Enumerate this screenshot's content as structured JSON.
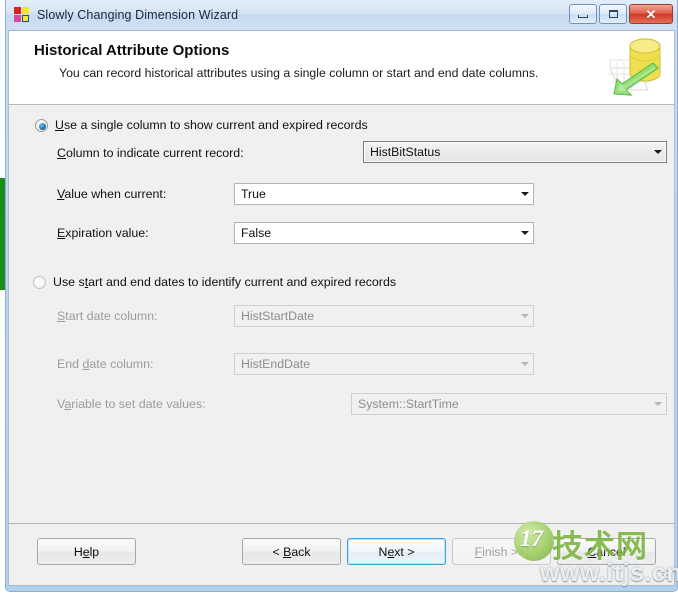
{
  "window": {
    "title": "Slowly Changing Dimension Wizard",
    "icon": "ssis-wizard-icon",
    "controls": {
      "minimize": "minimize-icon",
      "maximize": "maximize-icon",
      "close": "✕"
    }
  },
  "header": {
    "title": "Historical Attribute Options",
    "subtitle": "You can record historical attributes using a single column or start and end date columns.",
    "art": "database-cylinder-green-arrow-icon"
  },
  "options": {
    "single_column": {
      "label_pre": "",
      "label_acc": "U",
      "label_post": "se a single column to show current and expired records",
      "selected": true,
      "fields": [
        {
          "label_pre": "",
          "label_acc": "C",
          "label_post": "olumn to indicate current record:",
          "value": "HistBitStatus",
          "name": "column-to-indicate-current-record",
          "focused": true
        },
        {
          "label_pre": "",
          "label_acc": "V",
          "label_post": "alue when current:",
          "value": "True",
          "name": "value-when-current",
          "focused": false
        },
        {
          "label_pre": "",
          "label_acc": "E",
          "label_post": "xpiration value:",
          "value": "False",
          "name": "expiration-value",
          "focused": false
        }
      ]
    },
    "start_end_dates": {
      "label_pre": "Use s",
      "label_acc": "t",
      "label_post": "art and end dates to identify current and expired records",
      "selected": false,
      "fields": [
        {
          "label_pre": "",
          "label_acc": "S",
          "label_post": "tart date column:",
          "value": "HistStartDate",
          "name": "start-date-column"
        },
        {
          "label_pre": "End ",
          "label_acc": "d",
          "label_post": "ate column:",
          "value": "HistEndDate",
          "name": "end-date-column"
        },
        {
          "label_pre": "V",
          "label_acc": "a",
          "label_post": "riable to set date values:",
          "value": "System::StartTime",
          "name": "variable-to-set-date-values"
        }
      ]
    }
  },
  "footer": {
    "help": {
      "pre": "H",
      "acc": "e",
      "post": "lp"
    },
    "back": {
      "pre": "< ",
      "acc": "B",
      "post": "ack"
    },
    "next": {
      "pre": "N",
      "acc": "e",
      "post": "xt >"
    },
    "finish": {
      "pre": "",
      "acc": "F",
      "post": "inish >>|"
    },
    "cancel": {
      "pre": "",
      "acc": "C",
      "post": "ancel"
    }
  },
  "watermark": {
    "logo_letter": "17",
    "chinese": "技术网",
    "url": "www.itjs.cn"
  },
  "colors": {
    "accent": "#3aa3e0",
    "title_bar": "#cfe0f4",
    "body": "#f0f0f0",
    "close_button": "#cf3a26",
    "watermark_green": "#7bb33e"
  }
}
